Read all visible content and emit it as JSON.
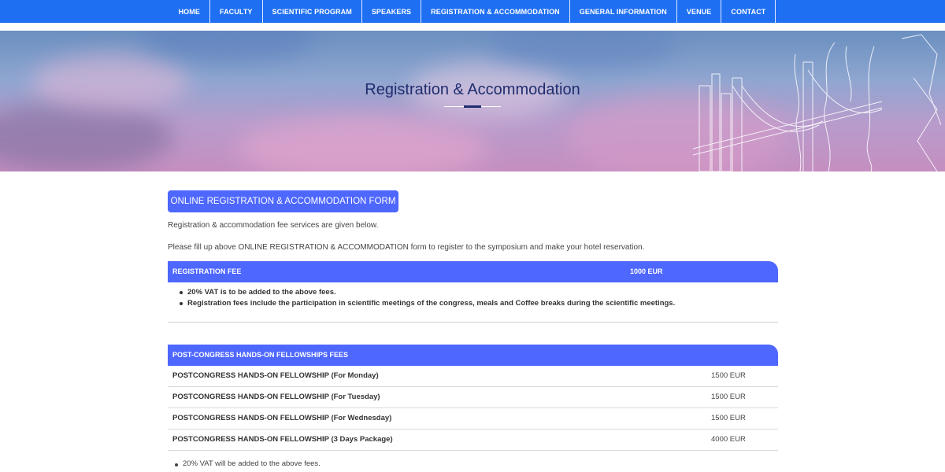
{
  "nav": {
    "items": [
      {
        "label": "HOME"
      },
      {
        "label": "FACULTY"
      },
      {
        "label": "SCIENTIFIC PROGRAM"
      },
      {
        "label": "SPEAKERS"
      },
      {
        "label": "REGISTRATION & ACCOMMODATION"
      },
      {
        "label": "GENERAL INFORMATION"
      },
      {
        "label": "VENUE"
      },
      {
        "label": "CONTACT"
      }
    ]
  },
  "hero": {
    "title": "Registration & Accommodation"
  },
  "content": {
    "form_button": "ONLINE REGISTRATION & ACCOMMODATION FORM",
    "intro_1": "Registration & accommodation fee services are given below.",
    "intro_2": "Please fill up above ONLINE REGISTRATION & ACCOMMODATION form to register to the symposium and make your hotel reservation."
  },
  "registration": {
    "header_label": "REGISTRATION FEE",
    "header_value": "1000 EUR",
    "bullets": [
      "20% VAT is to be added to the above fees.",
      "Registration fees include the participation in scientific meetings of the congress, meals and Coffee breaks during the scientific meetings."
    ]
  },
  "fellowships": {
    "header_label": "POST-CONGRESS HANDS-ON FELLOWSHIPS FEES",
    "rows": [
      {
        "name": "POSTCONGRESS HANDS-ON FELLOWSHIP (For Monday)",
        "price": "1500 EUR"
      },
      {
        "name": "POSTCONGRESS HANDS-ON FELLOWSHIP (For Tuesday)",
        "price": "1500 EUR"
      },
      {
        "name": "POSTCONGRESS HANDS-ON FELLOWSHIP (For Wednesday)",
        "price": "1500 EUR"
      },
      {
        "name": "POSTCONGRESS HANDS-ON FELLOWSHIP (3 Days Package)",
        "price": "4000 EUR"
      }
    ],
    "note": "20% VAT will be added to the above fees."
  },
  "colors": {
    "nav_bg": "#1f6ff2",
    "accent": "#4e67ff",
    "title": "#1f2d6e"
  }
}
